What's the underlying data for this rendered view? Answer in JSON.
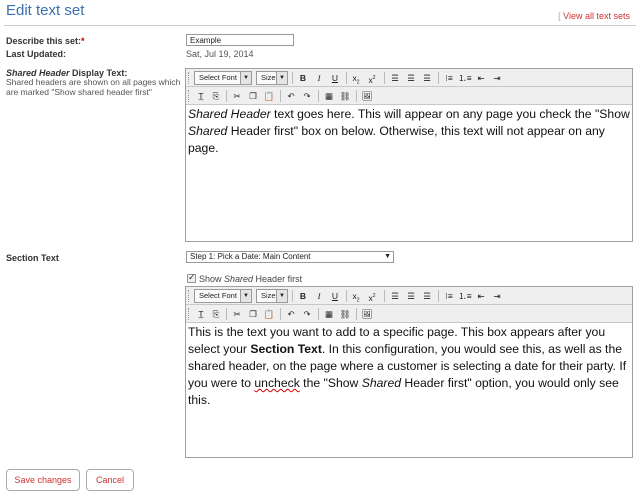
{
  "header": {
    "title": "Edit text set",
    "view_all_link": "View all text sets",
    "bracket": "["
  },
  "form": {
    "describe_label": "Describe this set:",
    "describe_required": "*",
    "describe_value": "Example",
    "last_updated_label": "Last Updated:",
    "last_updated_value": "Sat, Jul 19, 2014",
    "shared_label_italic": "Shared Header",
    "shared_label_rest": " Display Text:",
    "shared_help": "Shared headers are shown on all pages which are marked \"Show shared header first\"",
    "section_label": "Section Text",
    "section_select_value": "Step 1: Pick a Date: Main Content",
    "show_checkbox_label_a": "Show ",
    "show_checkbox_label_italic": "Shared",
    "show_checkbox_label_b": " Header first"
  },
  "toolbar": {
    "font_label": "Select Font",
    "size_label": "Size",
    "bold": "B",
    "italic": "I",
    "underline": "U",
    "subscript": "x",
    "superscript": "x"
  },
  "editor1": {
    "p1_italic": "Shared Header",
    "p1_rest1": " text goes here. This will appear on any page you check the \"Show ",
    "p1_italic2": "Shared",
    "p1_rest2": " Header first\" box on below. Otherwise, this text will not appear on any page."
  },
  "editor2": {
    "p1": "This is the text you want to add to a specific page. This box appears after you select your ",
    "p1_bold": "Section Text",
    "p2": ". In this configuration, you would see this, as well as the shared header, on the page where a customer is selecting a date for their party. If you were to ",
    "p2_squig": "uncheck",
    "p3": " the \"Show ",
    "p3_italic": "Shared",
    "p4": " Header first\" option, you would only see this."
  },
  "buttons": {
    "save": "Save changes",
    "cancel": "Cancel"
  },
  "colors": {
    "title": "#3a6fb0",
    "link": "#cc3333",
    "required": "#cc0000"
  }
}
